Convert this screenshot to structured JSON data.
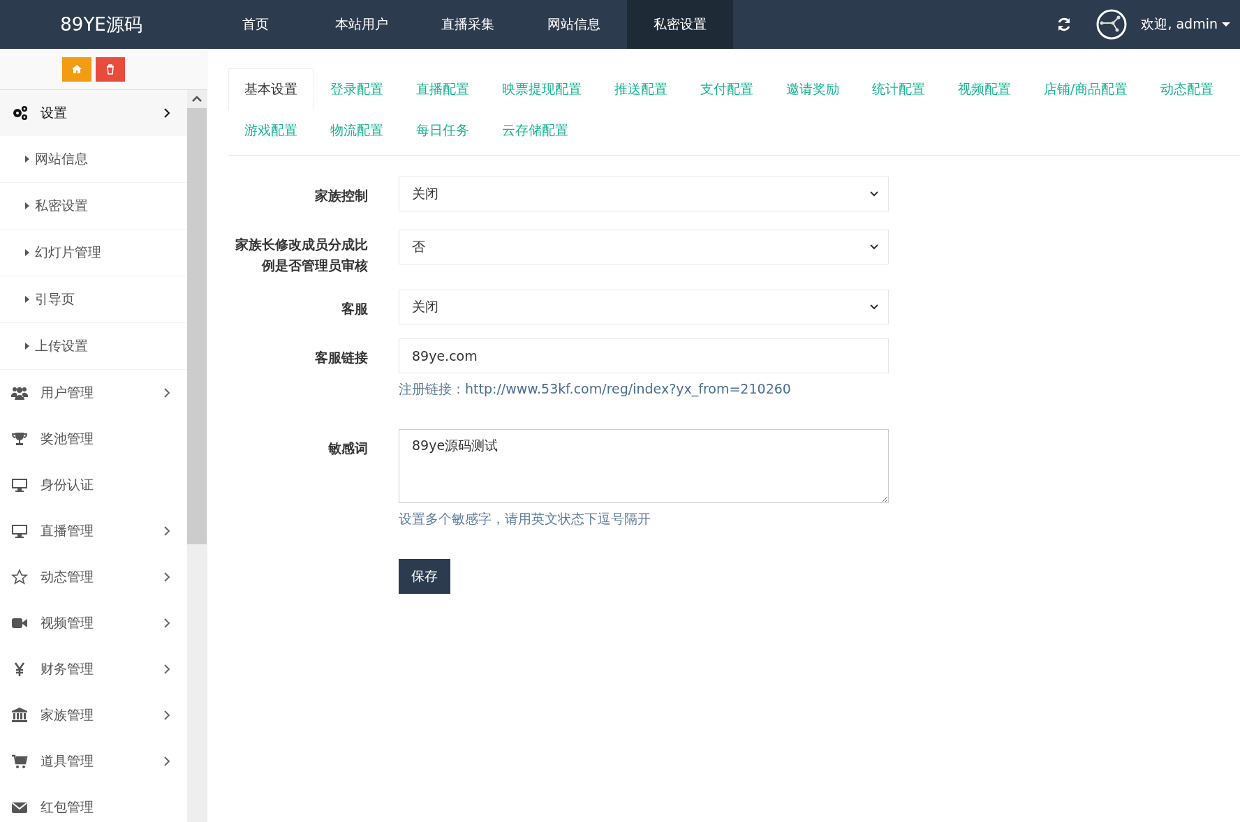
{
  "topbar": {
    "logo": "89YE源码",
    "nav": [
      {
        "label": "首页",
        "selected": false
      },
      {
        "label": "本站用户",
        "selected": false
      },
      {
        "label": "直播采集",
        "selected": false
      },
      {
        "label": "网站信息",
        "selected": false
      },
      {
        "label": "私密设置",
        "selected": true
      }
    ],
    "user": "欢迎, admin"
  },
  "sidebar": {
    "items": [
      {
        "label": "设置",
        "has_submenu": true,
        "expanded": true,
        "children": [
          {
            "label": "网站信息"
          },
          {
            "label": "私密设置"
          },
          {
            "label": "幻灯片管理"
          },
          {
            "label": "引导页"
          },
          {
            "label": "上传设置"
          }
        ]
      },
      {
        "label": "用户管理",
        "has_submenu": true,
        "expanded": false
      },
      {
        "label": "奖池管理",
        "has_submenu": false,
        "expanded": false
      },
      {
        "label": "身份认证",
        "has_submenu": false,
        "expanded": false
      },
      {
        "label": "直播管理",
        "has_submenu": true,
        "expanded": false
      },
      {
        "label": "动态管理",
        "has_submenu": true,
        "expanded": false
      },
      {
        "label": "视频管理",
        "has_submenu": true,
        "expanded": false
      },
      {
        "label": "财务管理",
        "has_submenu": true,
        "expanded": false
      },
      {
        "label": "家族管理",
        "has_submenu": true,
        "expanded": false
      },
      {
        "label": "道具管理",
        "has_submenu": true,
        "expanded": false
      },
      {
        "label": "红包管理",
        "has_submenu": false,
        "expanded": false
      }
    ]
  },
  "tabs": [
    {
      "label": "基本设置",
      "selected": true
    },
    {
      "label": "登录配置",
      "selected": false
    },
    {
      "label": "直播配置",
      "selected": false
    },
    {
      "label": "映票提现配置",
      "selected": false
    },
    {
      "label": "推送配置",
      "selected": false
    },
    {
      "label": "支付配置",
      "selected": false
    },
    {
      "label": "邀请奖励",
      "selected": false
    },
    {
      "label": "统计配置",
      "selected": false
    },
    {
      "label": "视频配置",
      "selected": false
    },
    {
      "label": "店铺/商品配置",
      "selected": false
    },
    {
      "label": "动态配置",
      "selected": false
    },
    {
      "label": "游戏配置",
      "selected": false
    },
    {
      "label": "物流配置",
      "selected": false
    },
    {
      "label": "每日任务",
      "selected": false
    },
    {
      "label": "云存储配置",
      "selected": false
    }
  ],
  "form": {
    "fields": [
      {
        "kind": "select",
        "label": "家族控制",
        "value": "关闭"
      },
      {
        "kind": "select",
        "label": "家族长修改成员分成比例是否管理员审核",
        "value": "否"
      },
      {
        "kind": "select",
        "label": "客服",
        "value": "关闭"
      },
      {
        "kind": "text",
        "label": "客服链接",
        "value": "89ye.com",
        "help": "注册链接：",
        "help_link": "http://www.53kf.com/reg/index?yx_from=210260"
      },
      {
        "kind": "textarea",
        "label": "敏感词",
        "value": "89ye源码测试",
        "help": "设置多个敏感字，请用英文状态下逗号隔开"
      }
    ],
    "submit": "保存"
  }
}
